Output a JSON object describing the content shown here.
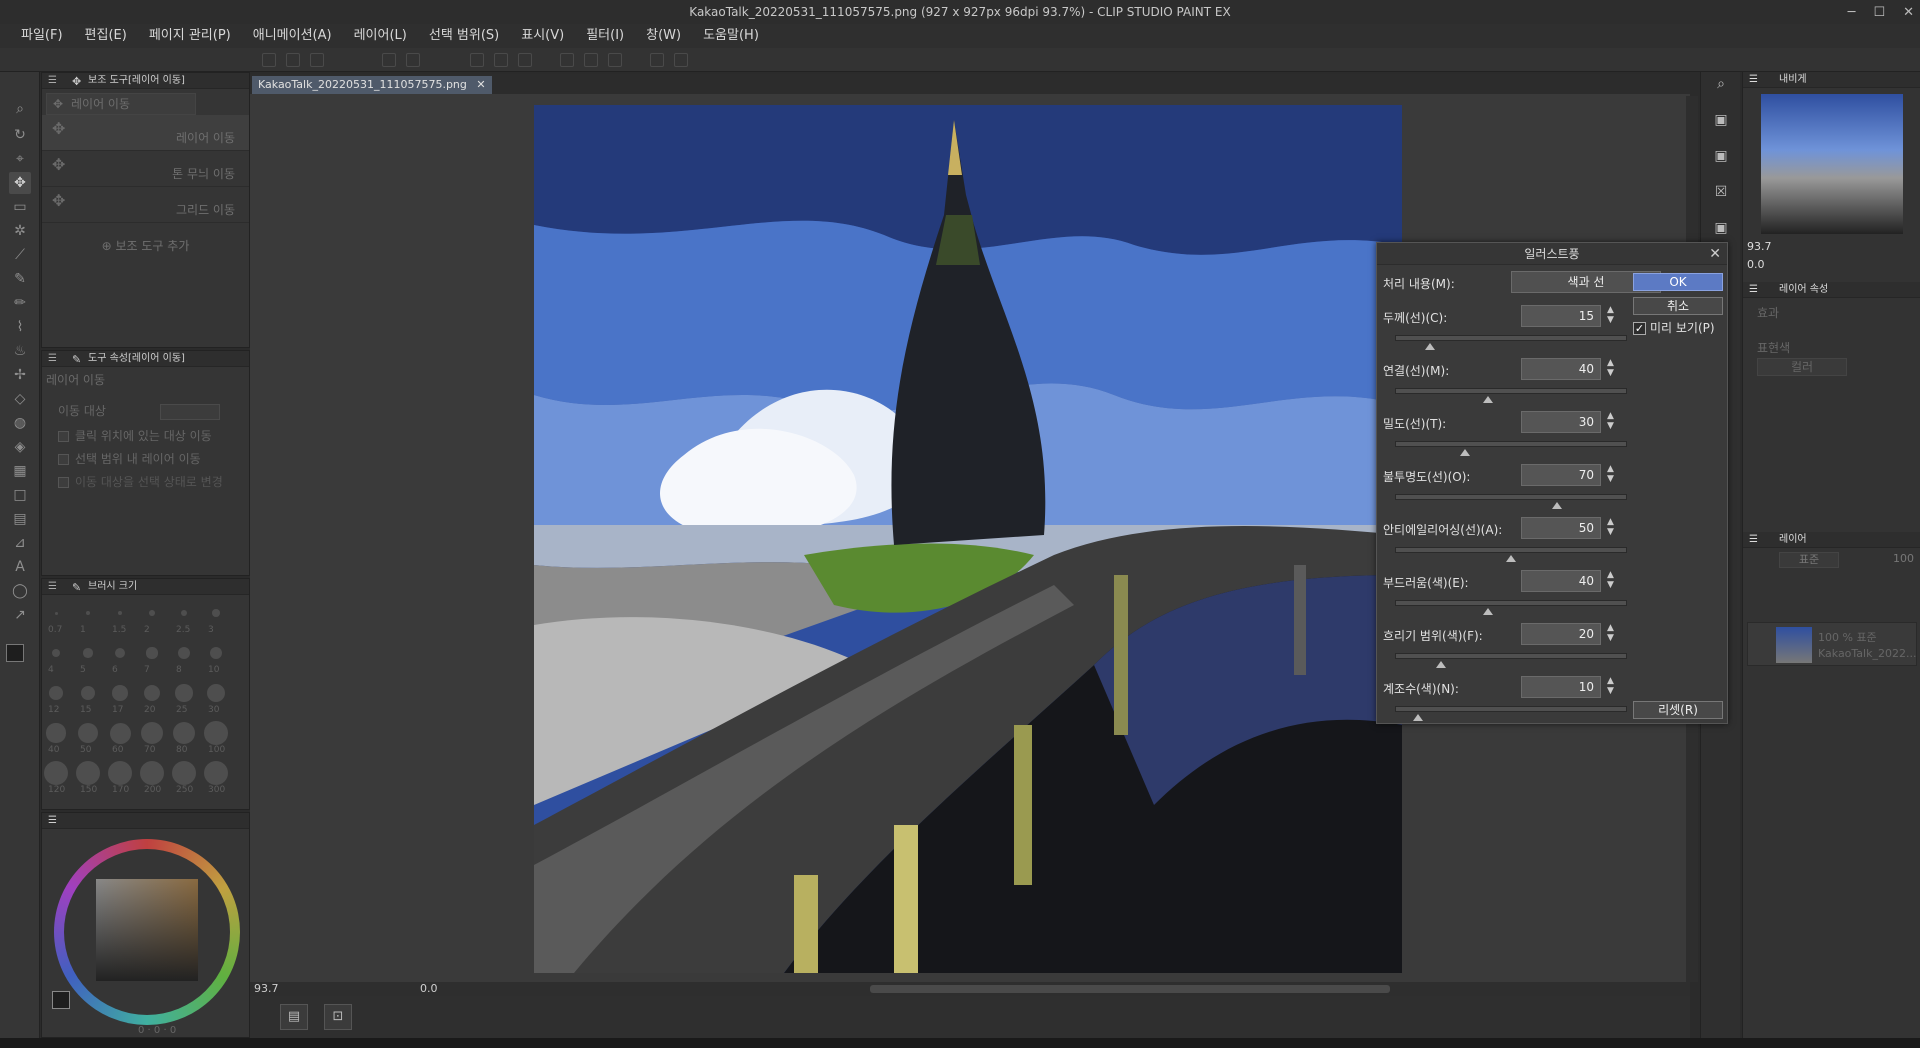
{
  "window": {
    "title": "KakaoTalk_20220531_111057575.png (927 x 927px 96dpi 93.7%)  - CLIP STUDIO PAINT EX",
    "minimize": "─",
    "maximize": "☐",
    "close": "✕"
  },
  "menu": [
    "파일(F)",
    "편집(E)",
    "페이지 관리(P)",
    "애니메이션(A)",
    "레이어(L)",
    "선택 범위(S)",
    "표시(V)",
    "필터(I)",
    "창(W)",
    "도움말(H)"
  ],
  "subtool_panel": {
    "title": "보조 도구[레이어 이동]",
    "group_label": "레이어 이동",
    "items": [
      "레이어 이동",
      "톤 무늬 이동",
      "그리드 이동"
    ],
    "add_label": "보조 도구 추가"
  },
  "tool_property": {
    "title": "도구 속성[레이어 이동]",
    "name": "레이어 이동",
    "target_label": "이동 대상",
    "options": [
      "클릭 위치에 있는 대상 이동",
      "선택 범위 내 레이어 이동",
      "이동 대상을 선택 상태로 변경"
    ]
  },
  "brush_size": {
    "title": "브러시 크기",
    "sizes": [
      "0.7",
      "1",
      "1.5",
      "2",
      "2.5",
      "3",
      "4",
      "5",
      "6",
      "7",
      "8",
      "10",
      "12",
      "15",
      "17",
      "20",
      "25",
      "30",
      "40",
      "50",
      "60",
      "70",
      "80",
      "100",
      "120",
      "150",
      "170",
      "200",
      "250",
      "300"
    ]
  },
  "color_panel": {
    "values": [
      "0",
      "0",
      "0"
    ]
  },
  "document": {
    "tab": "KakaoTalk_20220531_111057575.png",
    "tab_close": "✕",
    "zoom": "93.7",
    "angle": "0.0"
  },
  "navigator": {
    "title": "내비게",
    "zoom": "93.7",
    "angle": "0.0"
  },
  "layer_property": {
    "title": "레이어 속성",
    "effect_label": "효과",
    "color_label": "표현색",
    "color_value": "컬러"
  },
  "layer_panel": {
    "title": "레이어",
    "blend": "표준",
    "opacity": "100",
    "layer_line1": "100 % 표준",
    "layer_line2": "KakaoTalk_2022..."
  },
  "dialog": {
    "title": "일러스트풍",
    "mode_label": "처리 내용(M):",
    "mode_value": "색과 선",
    "ok": "OK",
    "cancel": "취소",
    "preview_label": "미리 보기(P)",
    "preview_checked": true,
    "reset": "리셋(R)",
    "params": [
      {
        "label": "두께(선)(C):",
        "value": "15",
        "fraction": 0.15
      },
      {
        "label": "연결(선)(M):",
        "value": "40",
        "fraction": 0.4
      },
      {
        "label": "밀도(선)(T):",
        "value": "30",
        "fraction": 0.3
      },
      {
        "label": "불투명도(선)(O):",
        "value": "70",
        "fraction": 0.7
      },
      {
        "label": "안티에일리어싱(선)(A):",
        "value": "50",
        "fraction": 0.5
      },
      {
        "label": "부드러움(색)(E):",
        "value": "40",
        "fraction": 0.4
      },
      {
        "label": "흐리기 범위(색)(F):",
        "value": "20",
        "fraction": 0.2
      },
      {
        "label": "계조수(색)(N):",
        "value": "10",
        "fraction": 0.1
      }
    ]
  },
  "colors": {
    "accent": "#5c7ac4",
    "tab": "#4f5a6a",
    "sky": "#3f63b8",
    "tower": "#1f2228"
  }
}
